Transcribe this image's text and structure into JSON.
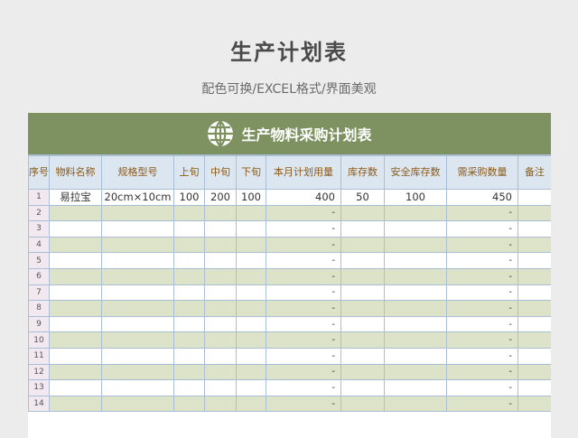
{
  "page": {
    "title": "生产计划表",
    "subtitle": "配色可换/EXCEL格式/界面美观"
  },
  "sheet": {
    "banner_title": "生产物料采购计划表",
    "banner_icon": "globe-icon",
    "colors": {
      "banner": "#7d9260",
      "header": "#dce6f1",
      "stripe": "#dde3c9",
      "index": "#f2e8ef",
      "header_text": "#8a5a18"
    },
    "headers": [
      "序号",
      "物料名称",
      "规格型号",
      "上旬",
      "中旬",
      "下旬",
      "本月计划用量",
      "库存数",
      "安全库存数",
      "需采购数量",
      "备注"
    ],
    "rows": [
      {
        "no": "1",
        "name": "易拉宝",
        "spec": "20cm×10cm",
        "early": "100",
        "mid": "200",
        "late": "100",
        "plan": "400",
        "stock": "50",
        "safe": "100",
        "need": "450",
        "note": ""
      },
      {
        "no": "2",
        "name": "",
        "spec": "",
        "early": "",
        "mid": "",
        "late": "",
        "plan": "-",
        "stock": "",
        "safe": "",
        "need": "-",
        "note": ""
      },
      {
        "no": "3",
        "name": "",
        "spec": "",
        "early": "",
        "mid": "",
        "late": "",
        "plan": "-",
        "stock": "",
        "safe": "",
        "need": "-",
        "note": ""
      },
      {
        "no": "4",
        "name": "",
        "spec": "",
        "early": "",
        "mid": "",
        "late": "",
        "plan": "-",
        "stock": "",
        "safe": "",
        "need": "-",
        "note": ""
      },
      {
        "no": "5",
        "name": "",
        "spec": "",
        "early": "",
        "mid": "",
        "late": "",
        "plan": "-",
        "stock": "",
        "safe": "",
        "need": "-",
        "note": ""
      },
      {
        "no": "6",
        "name": "",
        "spec": "",
        "early": "",
        "mid": "",
        "late": "",
        "plan": "-",
        "stock": "",
        "safe": "",
        "need": "-",
        "note": ""
      },
      {
        "no": "7",
        "name": "",
        "spec": "",
        "early": "",
        "mid": "",
        "late": "",
        "plan": "-",
        "stock": "",
        "safe": "",
        "need": "-",
        "note": ""
      },
      {
        "no": "8",
        "name": "",
        "spec": "",
        "early": "",
        "mid": "",
        "late": "",
        "plan": "-",
        "stock": "",
        "safe": "",
        "need": "-",
        "note": ""
      },
      {
        "no": "9",
        "name": "",
        "spec": "",
        "early": "",
        "mid": "",
        "late": "",
        "plan": "-",
        "stock": "",
        "safe": "",
        "need": "-",
        "note": ""
      },
      {
        "no": "10",
        "name": "",
        "spec": "",
        "early": "",
        "mid": "",
        "late": "",
        "plan": "-",
        "stock": "",
        "safe": "",
        "need": "-",
        "note": ""
      },
      {
        "no": "11",
        "name": "",
        "spec": "",
        "early": "",
        "mid": "",
        "late": "",
        "plan": "-",
        "stock": "",
        "safe": "",
        "need": "-",
        "note": ""
      },
      {
        "no": "12",
        "name": "",
        "spec": "",
        "early": "",
        "mid": "",
        "late": "",
        "plan": "-",
        "stock": "",
        "safe": "",
        "need": "-",
        "note": ""
      },
      {
        "no": "13",
        "name": "",
        "spec": "",
        "early": "",
        "mid": "",
        "late": "",
        "plan": "-",
        "stock": "",
        "safe": "",
        "need": "-",
        "note": ""
      },
      {
        "no": "14",
        "name": "",
        "spec": "",
        "early": "",
        "mid": "",
        "late": "",
        "plan": "-",
        "stock": "",
        "safe": "",
        "need": "-",
        "note": ""
      }
    ]
  }
}
